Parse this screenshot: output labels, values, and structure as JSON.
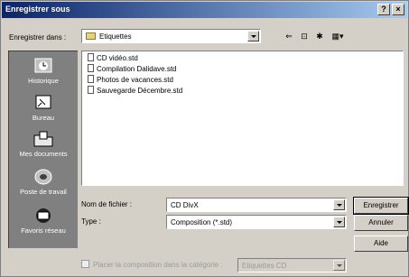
{
  "window": {
    "title": "Enregistrer sous",
    "help_glyph": "?",
    "close_glyph": "×"
  },
  "location": {
    "label": "Enregistrer dans :",
    "value": "Etiquettes"
  },
  "toolbar": {
    "back_glyph": "⇐",
    "up_glyph": "⊡",
    "new_folder_glyph": "✱",
    "view_glyph": "▦▾"
  },
  "places": [
    {
      "label": "Historique",
      "icon": "history-icon"
    },
    {
      "label": "Bureau",
      "icon": "desktop-icon"
    },
    {
      "label": "Mes documents",
      "icon": "documents-icon"
    },
    {
      "label": "Poste de travail",
      "icon": "computer-icon"
    },
    {
      "label": "Favoris réseau",
      "icon": "network-icon"
    }
  ],
  "files": [
    "CD vidéo.std",
    "Compilation Dalidave.std",
    "Photos de vacances.std",
    "Sauvegarde Décembre.std"
  ],
  "filename": {
    "label": "Nom de fichier :",
    "value": "CD DivX"
  },
  "filetype": {
    "label": "Type :",
    "value": "Composition (*.std)"
  },
  "buttons": {
    "save": "Enregistrer",
    "cancel": "Annuler",
    "help": "Aide"
  },
  "category": {
    "label": "Placer la composition dans la catégorie :",
    "value": "Etiquettes CD"
  }
}
